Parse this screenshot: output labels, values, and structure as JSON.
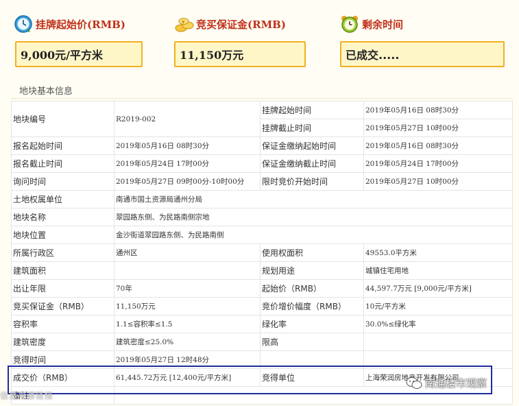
{
  "summary": {
    "start_price": {
      "label": "挂牌起始价(RMB)",
      "value": "9,000元/平方米",
      "icon": "clock-icon"
    },
    "deposit": {
      "label": "竞买保证金(RMB)",
      "value": "11,150万元",
      "icon": "coins-icon"
    },
    "remaining": {
      "label": "剩余时间",
      "value": "已成交.....",
      "icon": "alarm-clock-icon"
    }
  },
  "section_title": "地块基本信息",
  "table": {
    "plot_no_label": "地块编号",
    "plot_no": "R2019-002",
    "list_start_label": "挂牌起始时间",
    "list_start": "2019年05月16日 08时30分",
    "list_end_label": "挂牌截止时间",
    "list_end": "2019年05月27日 10时00分",
    "reg_start_label": "报名起始时间",
    "reg_start": "2019年05月16日 08时30分",
    "dep_start_label": "保证金缴纳起始时间",
    "dep_start": "2019年05月16日 08时30分",
    "reg_end_label": "报名截止时间",
    "reg_end": "2019年05月24日 17时00分",
    "dep_end_label": "保证金缴纳截止时间",
    "dep_end": "2019年05月24日 17时00分",
    "inquiry_label": "询问时间",
    "inquiry": "2019年05月27日 09时00分-10时00分",
    "bid_start_label": "限时竞价开始时间",
    "bid_start": "2019年05月27日 10时00分",
    "owner_label": "土地权属单位",
    "owner": "南通市国土资源局通州分局",
    "name_label": "地块名称",
    "name": "翠园路东侧、为民路南侧宗地",
    "location_label": "地块位置",
    "location": "金沙街道翠园路东侧、为民路南侧",
    "district_label": "所属行政区",
    "district": "通州区",
    "area_label": "使用权面积",
    "area": "49553.0平方米",
    "build_area_label": "建筑面积",
    "build_area": "",
    "usage_label": "规划用途",
    "usage": "城镇住宅用地",
    "term_label": "出让年限",
    "term": "70年",
    "start_price_label": "起始价（RMB）",
    "start_price": "44,597.7万元 [9,000元/平方米]",
    "deposit_label": "竞买保证金（RMB）",
    "deposit": "11,150万元",
    "increment_label": "竞价增价幅度（RMB）",
    "increment": "10元/平方米",
    "far_label": "容积率",
    "far": "1.1≤容积率≤1.5",
    "green_label": "绿化率",
    "green": "30.0%≤绿化率",
    "density_label": "建筑密度",
    "density": "建筑密度≤25.0%",
    "height_label": "限高",
    "height": "",
    "win_time_label": "竞得时间",
    "win_time": "2019年05月27日 12时48分",
    "deal_price_label": "成交价（RMB）",
    "deal_price": "61,445.72万元 [12,400元/平方米]",
    "winner_label": "竞得单位",
    "winner": "上海荣润房地产开发有限公司",
    "remark_label": "备注"
  },
  "watermark": "南通楼市观察",
  "bottom_text": "信息来源链接",
  "colors": {
    "label_red": "#c03018",
    "box_border": "#f0b020",
    "box_fill": "#fff6c8",
    "highlight": "#1c2c9c"
  }
}
